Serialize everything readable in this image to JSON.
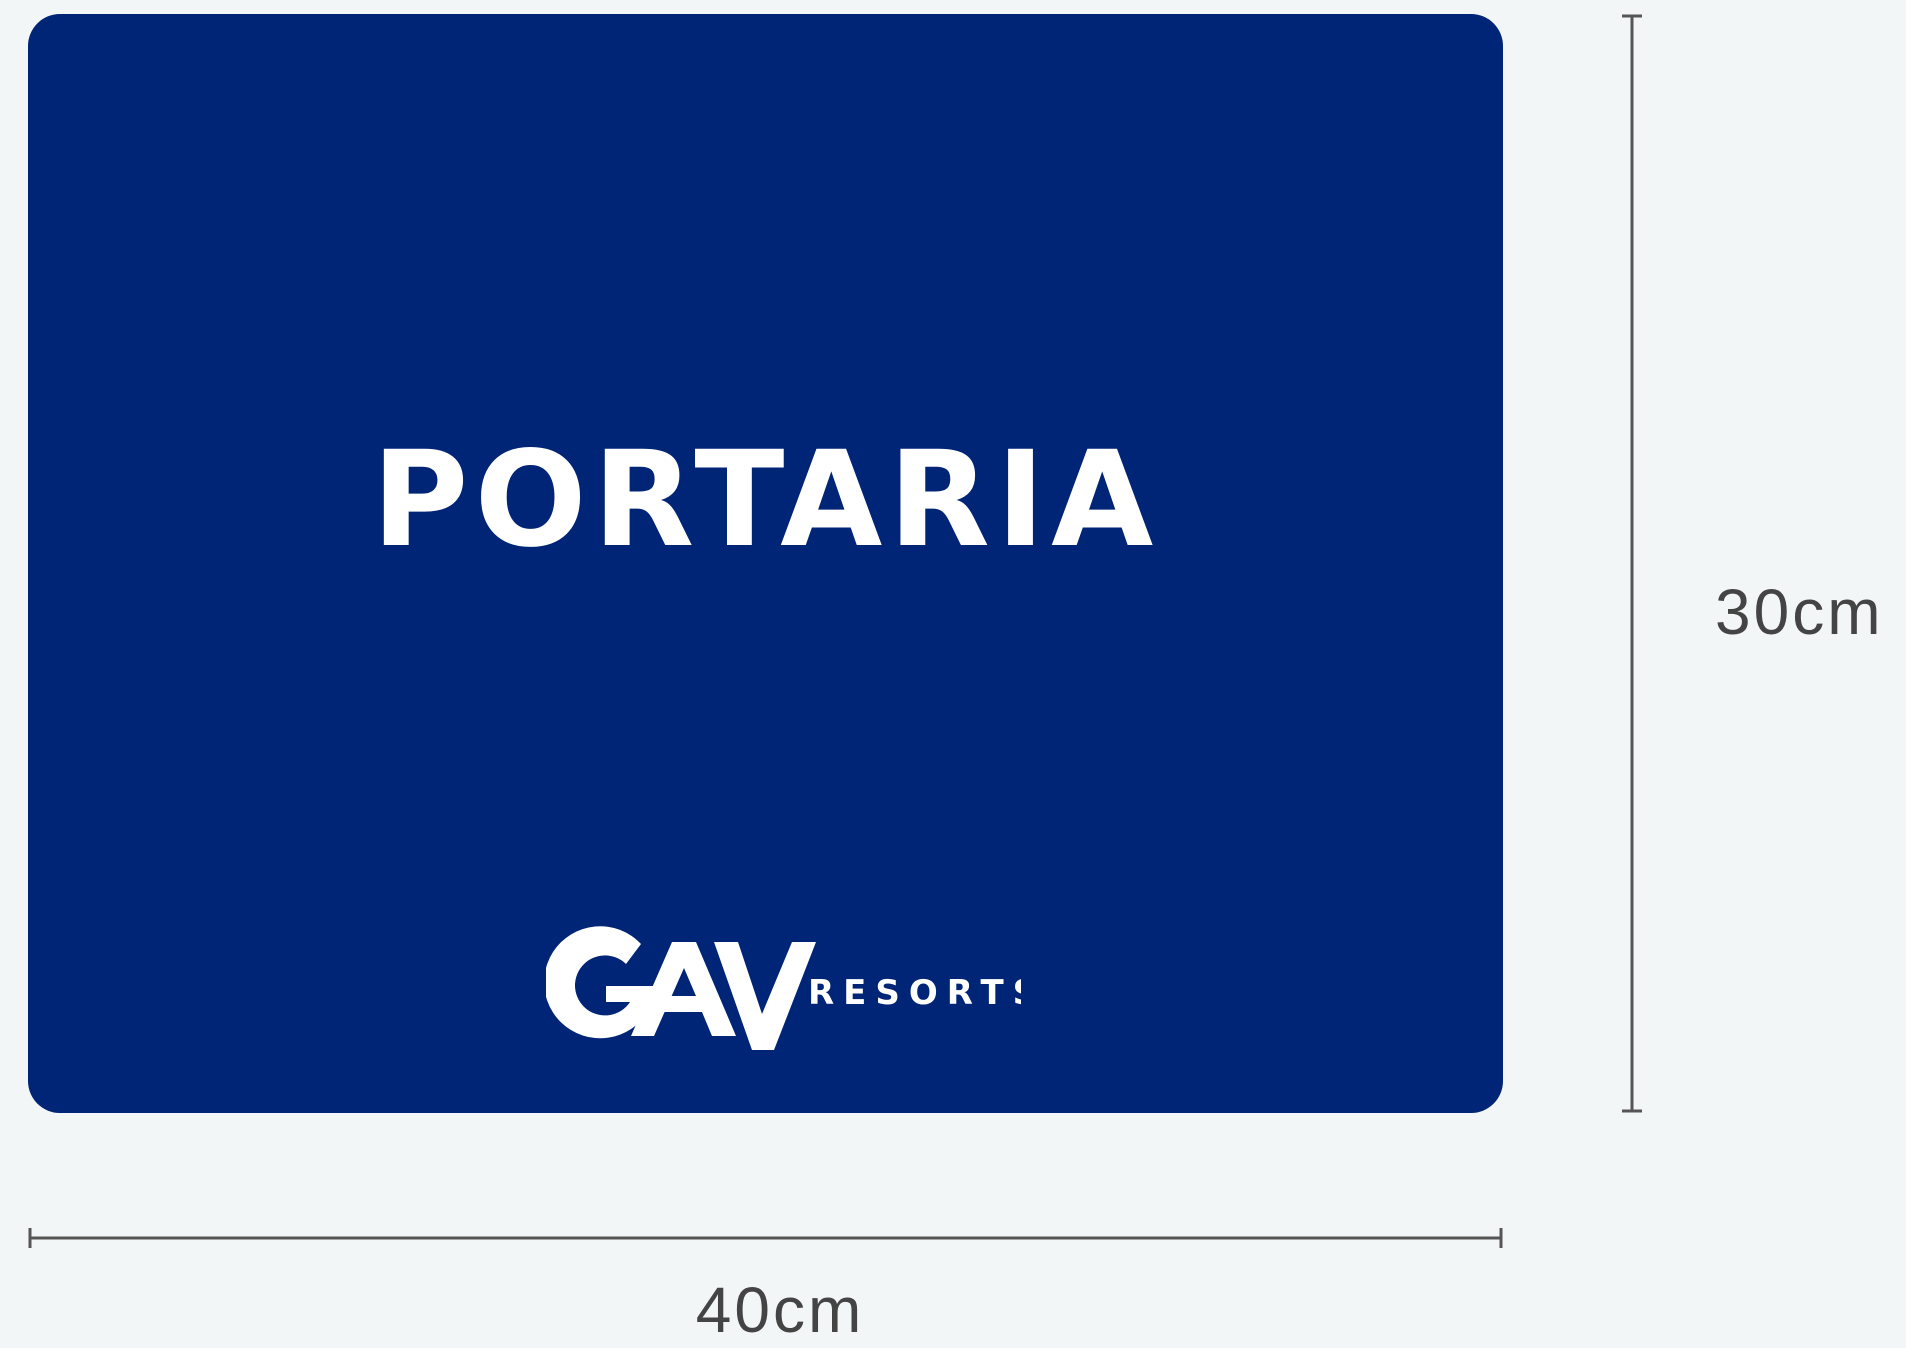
{
  "sign": {
    "title": "PORTARIA",
    "background_color": "#002476",
    "text_color": "#ffffff",
    "logo": {
      "mark": "GAV",
      "wordmark": "RESORTS"
    }
  },
  "dimensions": {
    "width_label": "40cm",
    "height_label": "30cm",
    "line_color": "#555555"
  }
}
